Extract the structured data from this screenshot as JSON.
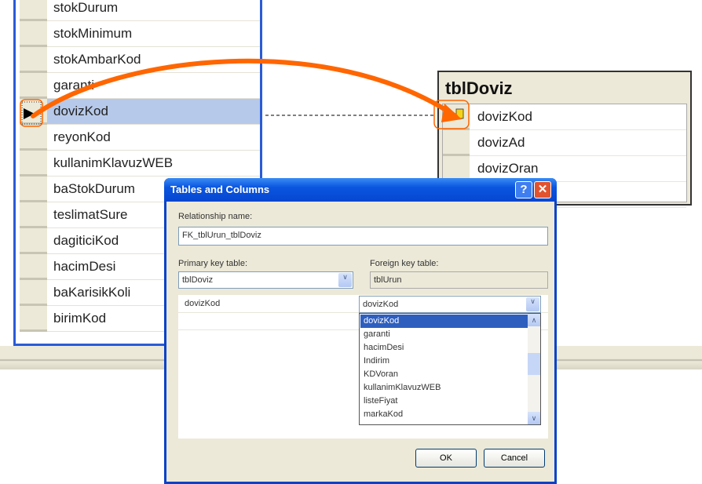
{
  "left_table": {
    "rows": [
      "stokDurum",
      "stokMinimum",
      "stokAmbarKod",
      "garanti",
      "dovizKod",
      "reyonKod",
      "kullanimKlavuzWEB",
      "baStokDurum",
      "teslimatSure",
      "dagiticiKod",
      "hacimDesi",
      "baKarisikKoli",
      "birimKod"
    ],
    "selected_row": "dovizKod"
  },
  "right_table": {
    "title": "tblDoviz",
    "rows": [
      "dovizKod",
      "dovizAd",
      "dovizOran",
      ""
    ],
    "key_icon": "primary-key-icon"
  },
  "dialog": {
    "title": "Tables and Columns",
    "help": "?",
    "close": "✕",
    "relationship_name_label": "Relationship name:",
    "relationship_name": "FK_tblUrun_tblDoviz",
    "primary_key_table_label": "Primary key table:",
    "primary_key_table": "tblDoviz",
    "foreign_key_table_label": "Foreign key table:",
    "foreign_key_table": "tblUrun",
    "pk_column": "dovizKod",
    "fk_column": "dovizKod",
    "dropdown_items": [
      "dovizKod",
      "garanti",
      "hacimDesi",
      "Indirim",
      "KDVoran",
      "kullanimKlavuzWEB",
      "listeFiyat",
      "markaKod"
    ],
    "ok": "OK",
    "cancel": "Cancel"
  },
  "colors": {
    "accent": "#ff6600",
    "titlebar": "#0a55df",
    "selection": "#2e5fbf"
  }
}
